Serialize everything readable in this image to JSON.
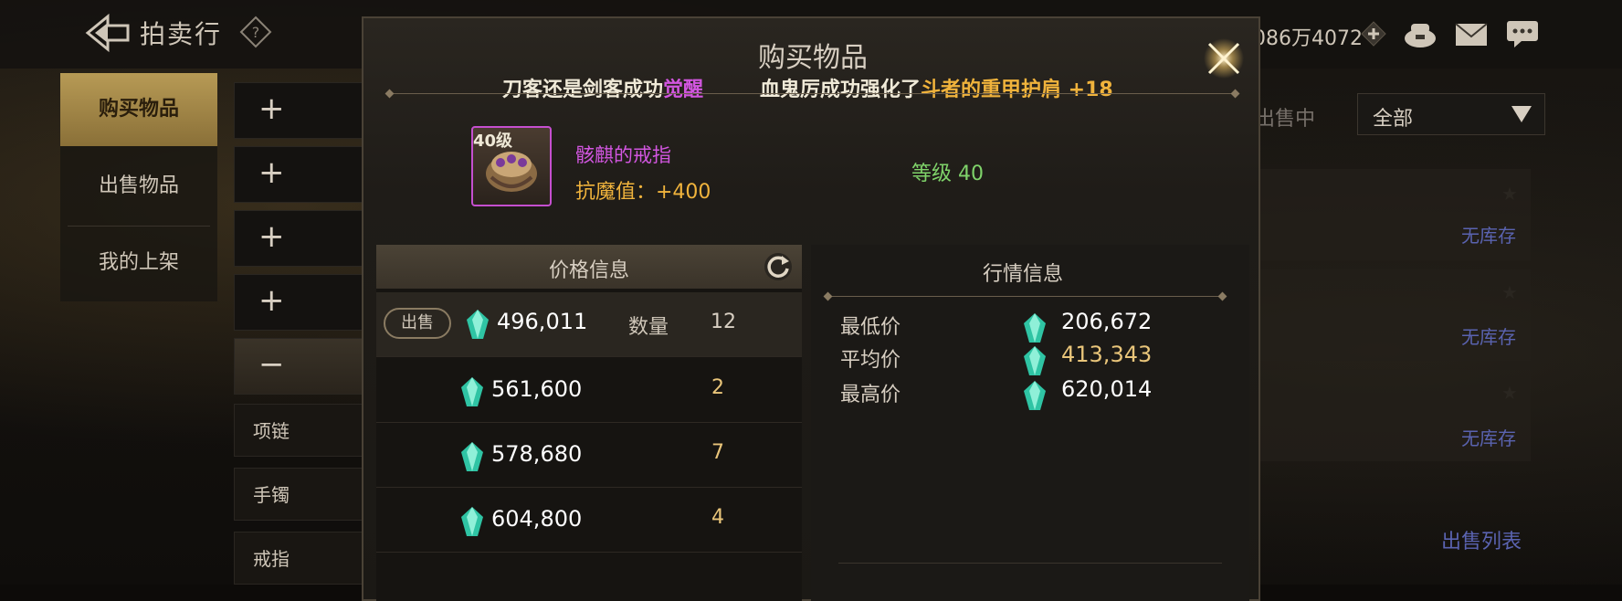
{
  "header": {
    "title": "拍卖行",
    "currency_text": "086万4072"
  },
  "left_nav": {
    "items": [
      {
        "label": "购买物品",
        "active": true
      },
      {
        "label": "出售物品",
        "active": false
      },
      {
        "label": "我的上架",
        "active": false
      }
    ]
  },
  "categories": {
    "subs": [
      "项链",
      "手镯",
      "戒指"
    ]
  },
  "right_panel": {
    "status_label": "出售中",
    "filter_value": "全部",
    "no_stock_text": "无库存",
    "sell_list_link": "出售列表"
  },
  "modal": {
    "title": "购买物品",
    "ticker": {
      "msg1_prefix": "刀客还是剑客成功",
      "msg1_highlight": "觉醒",
      "msg2_prefix": "血鬼厉成功强化了",
      "msg2_highlight": "斗者的重甲护肩 +18"
    },
    "item": {
      "level_badge": "40级",
      "name": "骸麒的戒指",
      "stat": "抗魔值：+400",
      "level_label": "等级 40"
    },
    "price_info": {
      "header": "价格信息",
      "sell_tag": "出售",
      "qty_label": "数量",
      "rows": [
        {
          "price": "496,011",
          "qty": "12"
        },
        {
          "price": "561,600",
          "qty": "2"
        },
        {
          "price": "578,680",
          "qty": "7"
        },
        {
          "price": "604,800",
          "qty": "4"
        }
      ]
    },
    "market_info": {
      "header": "行情信息",
      "rows": [
        {
          "label": "最低价",
          "value": "206,672"
        },
        {
          "label": "平均价",
          "value": "413,343"
        },
        {
          "label": "最高价",
          "value": "620,014"
        }
      ]
    }
  },
  "colors": {
    "accent_gold": "#f0b33c",
    "accent_purple": "#d256e0",
    "level_green": "#7fd36a",
    "link_blue": "#5a63b0"
  }
}
